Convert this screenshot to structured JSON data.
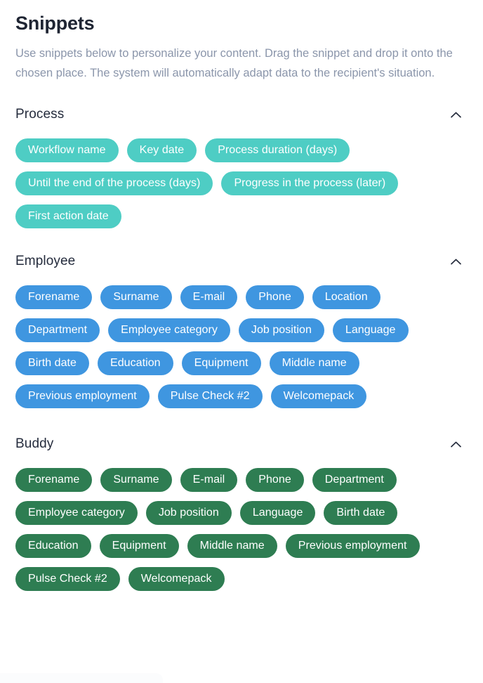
{
  "header": {
    "title": "Snippets",
    "description": "Use snippets below to personalize your content. Drag the snippet and drop it onto the chosen place. The system will automatically adapt data to the recipient's situation."
  },
  "colors": {
    "process_pill": "#4ecdc4",
    "employee_pill": "#3f96e0",
    "buddy_pill": "#2e7d52",
    "title_text": "#1f2533",
    "description_text": "#8b96ab",
    "section_title_text": "#252c3d",
    "pill_text": "#ffffff",
    "background": "#ffffff"
  },
  "sections": [
    {
      "title": "Process",
      "collapse_icon": "chevron-up-icon",
      "expanded": true,
      "snippets": [
        "Workflow name",
        "Key date",
        "Process duration (days)",
        "Until the end of the process (days)",
        "Progress in the process (later)",
        "First action date"
      ]
    },
    {
      "title": "Employee",
      "collapse_icon": "chevron-up-icon",
      "expanded": true,
      "snippets": [
        "Forename",
        "Surname",
        "E-mail",
        "Phone",
        "Location",
        "Department",
        "Employee category",
        "Job position",
        "Language",
        "Birth date",
        "Education",
        "Equipment",
        "Middle name",
        "Previous employment",
        "Pulse Check #2",
        "Welcomepack"
      ]
    },
    {
      "title": "Buddy",
      "collapse_icon": "chevron-up-icon",
      "expanded": true,
      "snippets": [
        "Forename",
        "Surname",
        "E-mail",
        "Phone",
        "Department",
        "Employee category",
        "Job position",
        "Language",
        "Birth date",
        "Education",
        "Equipment",
        "Middle name",
        "Previous employment",
        "Pulse Check #2",
        "Welcomepack"
      ]
    }
  ]
}
